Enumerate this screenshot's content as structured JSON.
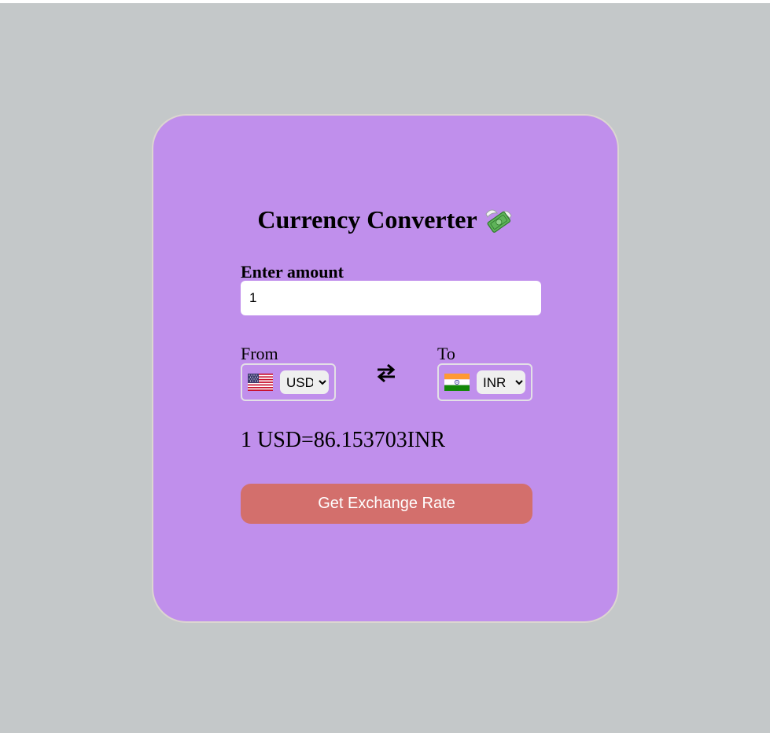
{
  "app": {
    "title": "Currency Converter",
    "title_icon": "money-with-wings-icon"
  },
  "amount": {
    "label": "Enter amount",
    "value": "1"
  },
  "from": {
    "label": "From",
    "currency": "USD",
    "flag_icon": "us-flag-icon"
  },
  "to": {
    "label": "To",
    "currency": "INR",
    "flag_icon": "india-flag-icon"
  },
  "swap_icon": "swap-arrows-icon",
  "result": {
    "text": "1 USD=86.153703INR"
  },
  "button": {
    "label": "Get Exchange Rate"
  },
  "colors": {
    "page_background": "#c4c8c9",
    "card_background": "#c08fec",
    "button_background": "#d36f6c",
    "button_text": "#ffffff"
  }
}
